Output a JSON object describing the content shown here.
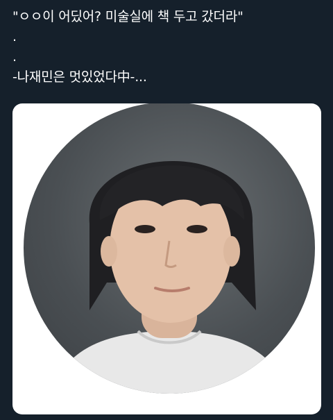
{
  "tweet": {
    "lines": [
      "\"ㅇㅇ이 어딨어? 미술실에 책 두고 갔더라\"",
      ".",
      ".",
      "-나재민은 멋있었다中-..."
    ]
  },
  "media": {
    "icon": "profile-photo",
    "background_color": "#15202b"
  }
}
